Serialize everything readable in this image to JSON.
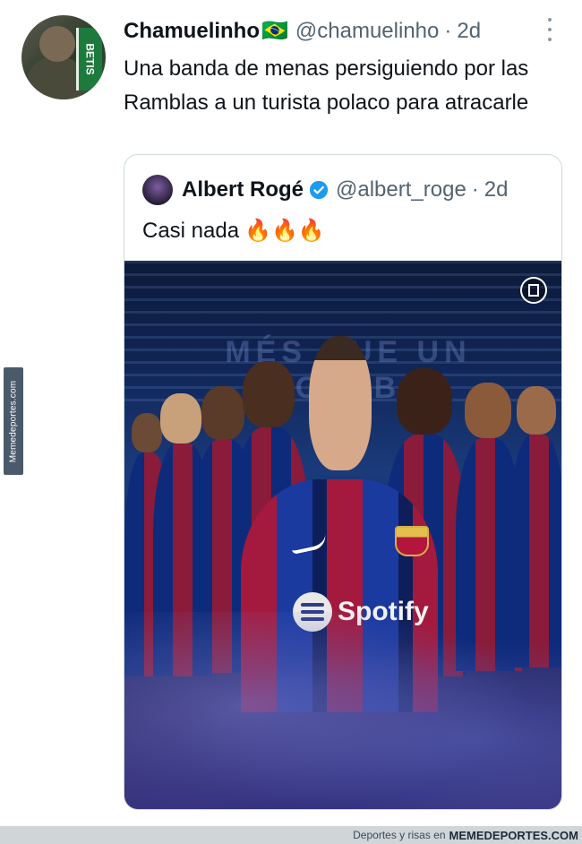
{
  "watermark": {
    "side_text": "Memedeportes.com",
    "bottom_prefix": "Deportes y risas en",
    "bottom_brand": "MEMEDEPORTES.COM"
  },
  "tweet": {
    "display_name": "Chamuelinho",
    "flag": "🇧🇷",
    "handle": "@chamuelinho",
    "separator": "·",
    "time": "2d",
    "text": "Una banda de menas persiguiendo por las Ramblas a un turista polaco para atracarle",
    "avatar_shirt_text": "BETIS",
    "more_icon": "more-vertical-icon"
  },
  "quoted_tweet": {
    "display_name": "Albert Rogé",
    "verified": true,
    "handle": "@albert_roge",
    "separator": "·",
    "time": "2d",
    "text": "Casi nada",
    "emoji": "🔥🔥🔥",
    "media": {
      "type": "gif",
      "background_text": "MÉS QUE UN CLUB",
      "sponsor_text": "Spotify"
    }
  },
  "colors": {
    "text_primary": "#0f1419",
    "text_secondary": "#536471",
    "verified_blue": "#1d9bf0",
    "card_border": "#cfd9de"
  }
}
